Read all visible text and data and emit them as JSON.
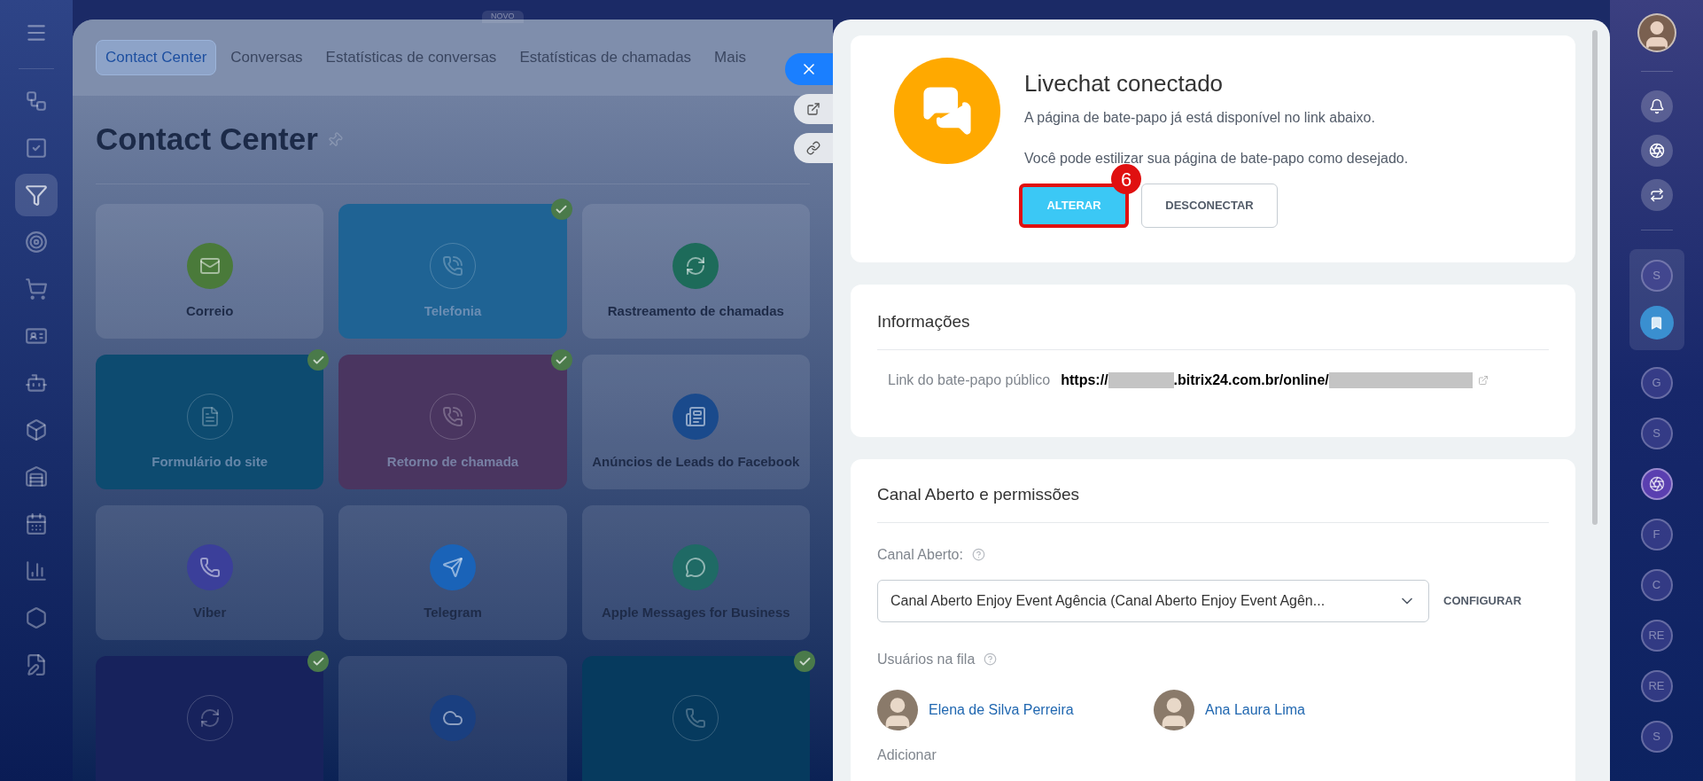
{
  "nav": [
    {
      "selected": false
    },
    {
      "selected": false
    },
    {
      "selected": true
    },
    {
      "selected": false
    },
    {
      "selected": false
    },
    {
      "selected": false
    },
    {
      "selected": false
    },
    {
      "selected": false
    },
    {
      "selected": false
    },
    {
      "selected": false
    },
    {
      "selected": false
    },
    {
      "selected": false
    },
    {
      "selected": false
    }
  ],
  "badge_new": "NOVO",
  "tabs": [
    {
      "label": "Contact Center",
      "selected": true
    },
    {
      "label": "Conversas",
      "selected": false
    },
    {
      "label": "Estatísticas de conversas",
      "selected": false
    },
    {
      "label": "Estatísticas de chamadas",
      "selected": false
    },
    {
      "label": "Mais",
      "selected": false
    }
  ],
  "page_title": "Contact Center",
  "tiles": [
    {
      "label": "Correio",
      "connected": false,
      "color": "#4a7a3a"
    },
    {
      "label": "Telefonia",
      "connected": true,
      "color": "#1f6394"
    },
    {
      "label": "Rastreamento de chamadas",
      "connected": false,
      "color": "#1d6b5a"
    },
    {
      "label": "Formulário do site",
      "connected": true,
      "color": "#0d4b70"
    },
    {
      "label": "Retorno de chamada",
      "connected": true,
      "color": "#4a3560"
    },
    {
      "label": "Anúncios de Leads do Facebook",
      "connected": false,
      "color": "#1a4a8c"
    },
    {
      "label": "Viber",
      "connected": false,
      "color": "#3b3f9a"
    },
    {
      "label": "Telegram",
      "connected": false,
      "color": "#1a63b8"
    },
    {
      "label": "Apple Messages for Business",
      "connected": false,
      "color": "#1f6a65"
    },
    {
      "connected": true,
      "color": "#17225c"
    },
    {
      "connected": false,
      "color": "#1a3f80"
    },
    {
      "connected": true,
      "color": "#063a5e"
    }
  ],
  "slider": {
    "status": {
      "title": "Livechat conectado",
      "lines": [
        "A página de bate-papo já está disponível no link abaixo.",
        "Você pode estilizar sua página de bate-papo como desejado."
      ],
      "buttons": [
        {
          "label": "ALTERAR",
          "kind": "primary",
          "callout": "6"
        },
        {
          "label": "DESCONECTAR",
          "kind": "secondary"
        }
      ]
    },
    "info": {
      "title": "Informações",
      "link_label": "Link do bate-papo público",
      "link_start": "https://",
      "link_middle": ".bitrix24.com.br/online/"
    },
    "channel": {
      "title": "Canal Aberto e permissões",
      "field_label": "Canal Aberto:",
      "select_value": "Canal Aberto Enjoy Event Agência (Canal Aberto Enjoy Event Agên...",
      "configure": "CONFIGURAR",
      "queue_label": "Usuários na fila",
      "users": [
        "Elena de Silva Perreira",
        "Ana Laura Lima"
      ],
      "add": "Adicionar"
    }
  },
  "right_bar": {
    "pinned": [
      {
        "kind": "letter",
        "label": "S"
      },
      {
        "kind": "bookmark"
      }
    ],
    "chats": [
      {
        "kind": "letter",
        "label": "G"
      },
      {
        "kind": "letter",
        "label": "S"
      },
      {
        "kind": "channel"
      },
      {
        "kind": "letter",
        "label": "F"
      },
      {
        "kind": "letter",
        "label": "C"
      },
      {
        "kind": "letter",
        "label": "RE"
      },
      {
        "kind": "letter",
        "label": "RE"
      },
      {
        "kind": "letter",
        "label": "S"
      }
    ]
  }
}
